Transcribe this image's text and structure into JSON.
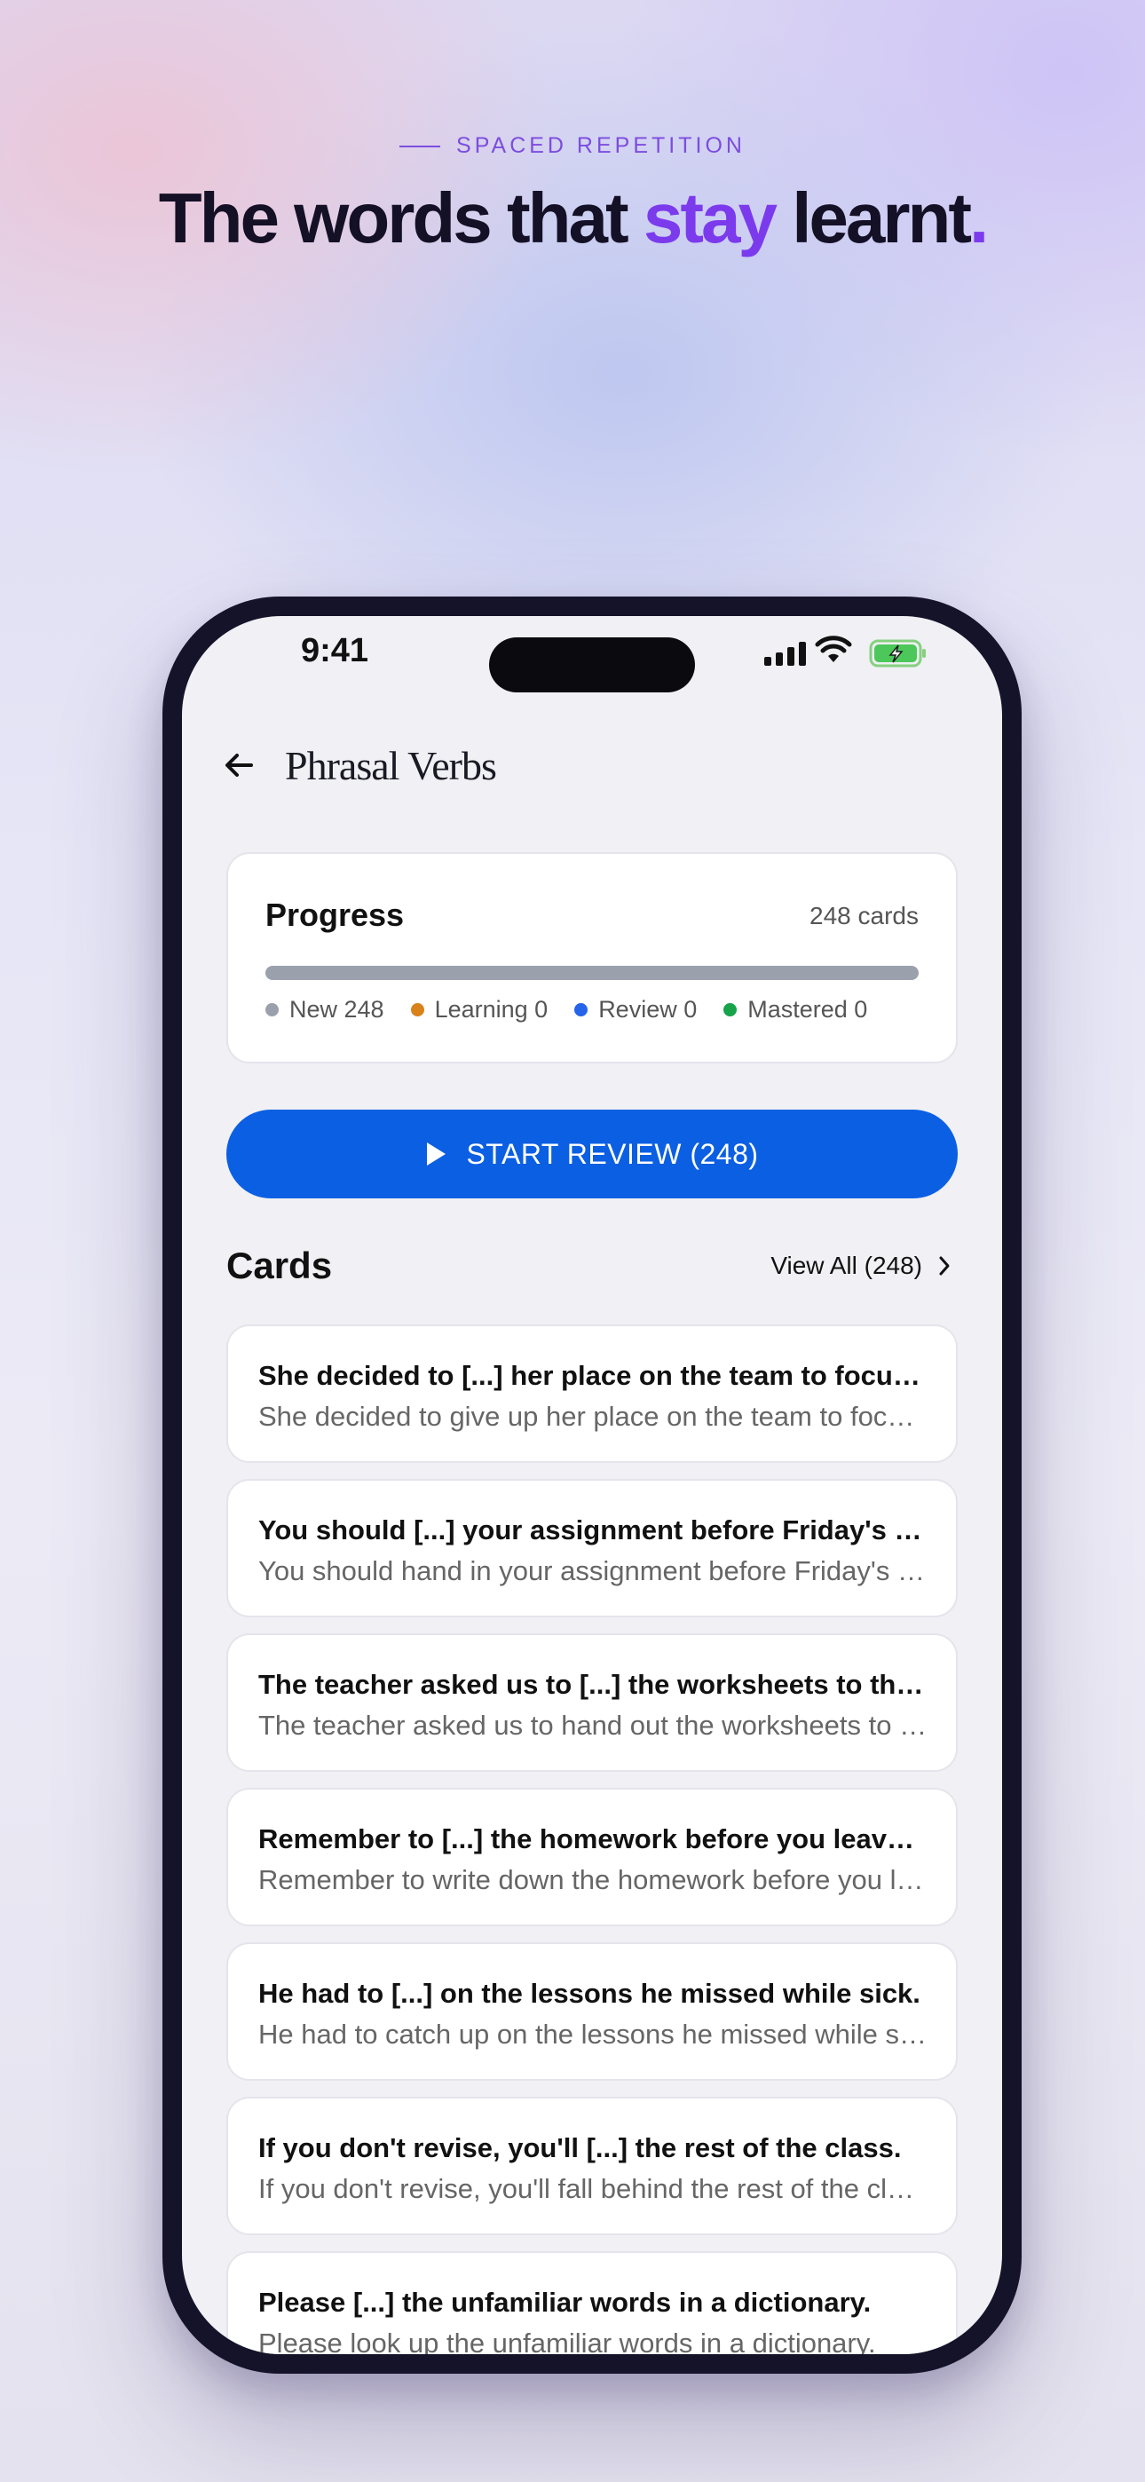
{
  "hero": {
    "eyebrow": "SPACED REPETITION",
    "headline_part1": "The words that ",
    "headline_accent": "stay",
    "headline_part2": " learnt",
    "headline_dot": "."
  },
  "status_bar": {
    "time": "9:41",
    "icons": [
      "cellular-signal-icon",
      "wifi-icon",
      "battery-charging-icon"
    ]
  },
  "nav": {
    "back_icon": "arrow-left-icon",
    "title": "Phrasal Verbs"
  },
  "progress": {
    "title": "Progress",
    "count_label": "248 cards",
    "fill_fraction": 0,
    "legend": [
      {
        "label": "New 248",
        "color": "#9aa1ad"
      },
      {
        "label": "Learning 0",
        "color": "#d9821a"
      },
      {
        "label": "Review 0",
        "color": "#2563eb"
      },
      {
        "label": "Mastered 0",
        "color": "#16a34a"
      }
    ]
  },
  "start_button": {
    "icon": "play-icon",
    "label": "START REVIEW (248)"
  },
  "cards_section": {
    "title": "Cards",
    "view_all": "View All (248)",
    "items": [
      {
        "prompt": "She decided to [...] her place on the team to focus on her studies.",
        "answer": "She decided to give up her place on the team to focus on her studies."
      },
      {
        "prompt": "You should [...] your assignment before Friday's deadline.",
        "answer": "You should hand in your assignment before Friday's deadline."
      },
      {
        "prompt": "The teacher asked us to [...] the worksheets to the class.",
        "answer": "The teacher asked us to hand out the worksheets to the class."
      },
      {
        "prompt": "Remember to [...] the homework before you leave the classroom.",
        "answer": "Remember to write down the homework before you leave the classroom."
      },
      {
        "prompt": "He had to [...] on the lessons he missed while sick.",
        "answer": "He had to catch up on the lessons he missed while sick."
      },
      {
        "prompt": "If you don't revise, you'll [...] the rest of the class.",
        "answer": "If you don't revise, you'll fall behind the rest of the class."
      },
      {
        "prompt": "Please [...] the unfamiliar words in a dictionary.",
        "answer": "Please look up the unfamiliar words in a dictionary."
      }
    ]
  }
}
